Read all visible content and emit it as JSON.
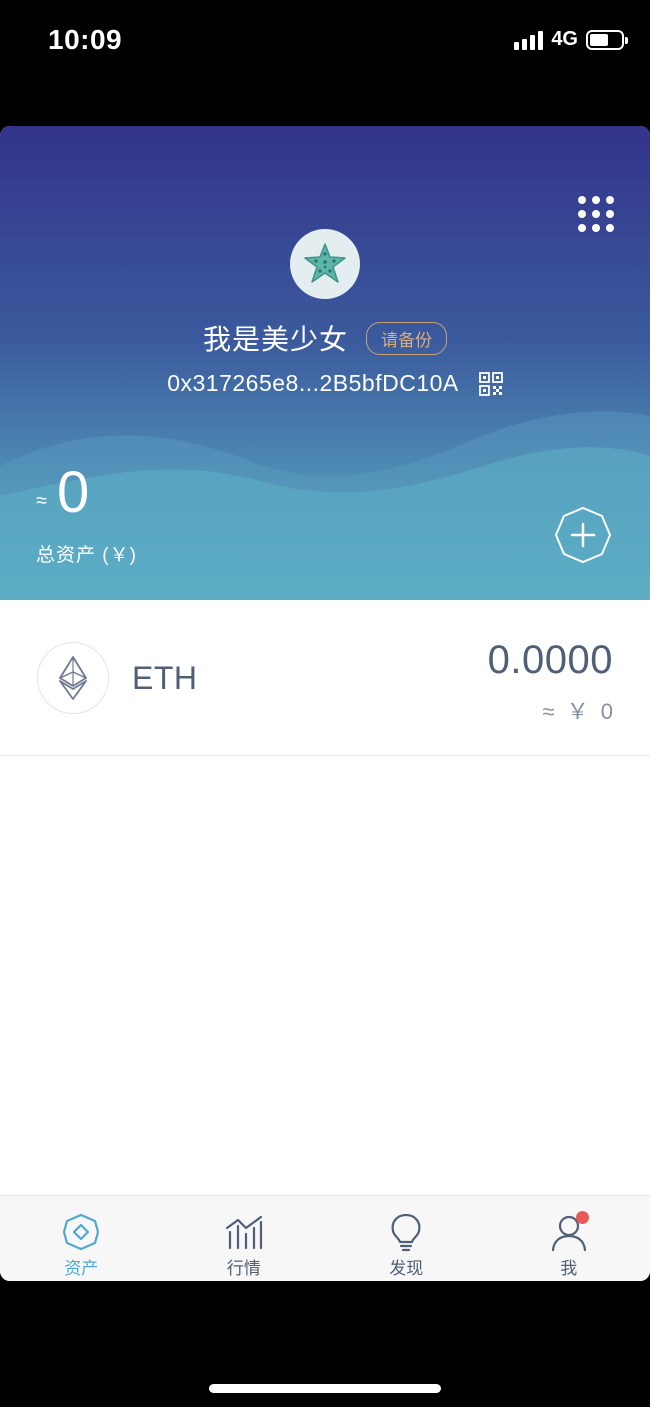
{
  "status_bar": {
    "time": "10:09",
    "network": "4G"
  },
  "header": {
    "wallet_name": "我是美少女",
    "backup_label": "请备份",
    "address": "0x317265e8...2B5bfDC10A",
    "approx_symbol": "≈",
    "total_value": "0",
    "total_label": "总资产 (￥)"
  },
  "assets": [
    {
      "symbol": "ETH",
      "balance": "0.0000",
      "fiat": "≈ ￥ 0"
    }
  ],
  "tabbar": {
    "items": [
      {
        "label": "资产",
        "icon": "assets-icon",
        "active": true
      },
      {
        "label": "行情",
        "icon": "market-chart-icon",
        "active": false
      },
      {
        "label": "发现",
        "icon": "lightbulb-icon",
        "active": false
      },
      {
        "label": "我",
        "icon": "profile-icon",
        "active": false
      }
    ]
  },
  "colors": {
    "header_top": "#33338a",
    "header_bottom": "#5fb6c6",
    "accent": "#4fa9d0",
    "badge": "#d8ad80",
    "notification_dot": "#e75a5a"
  }
}
